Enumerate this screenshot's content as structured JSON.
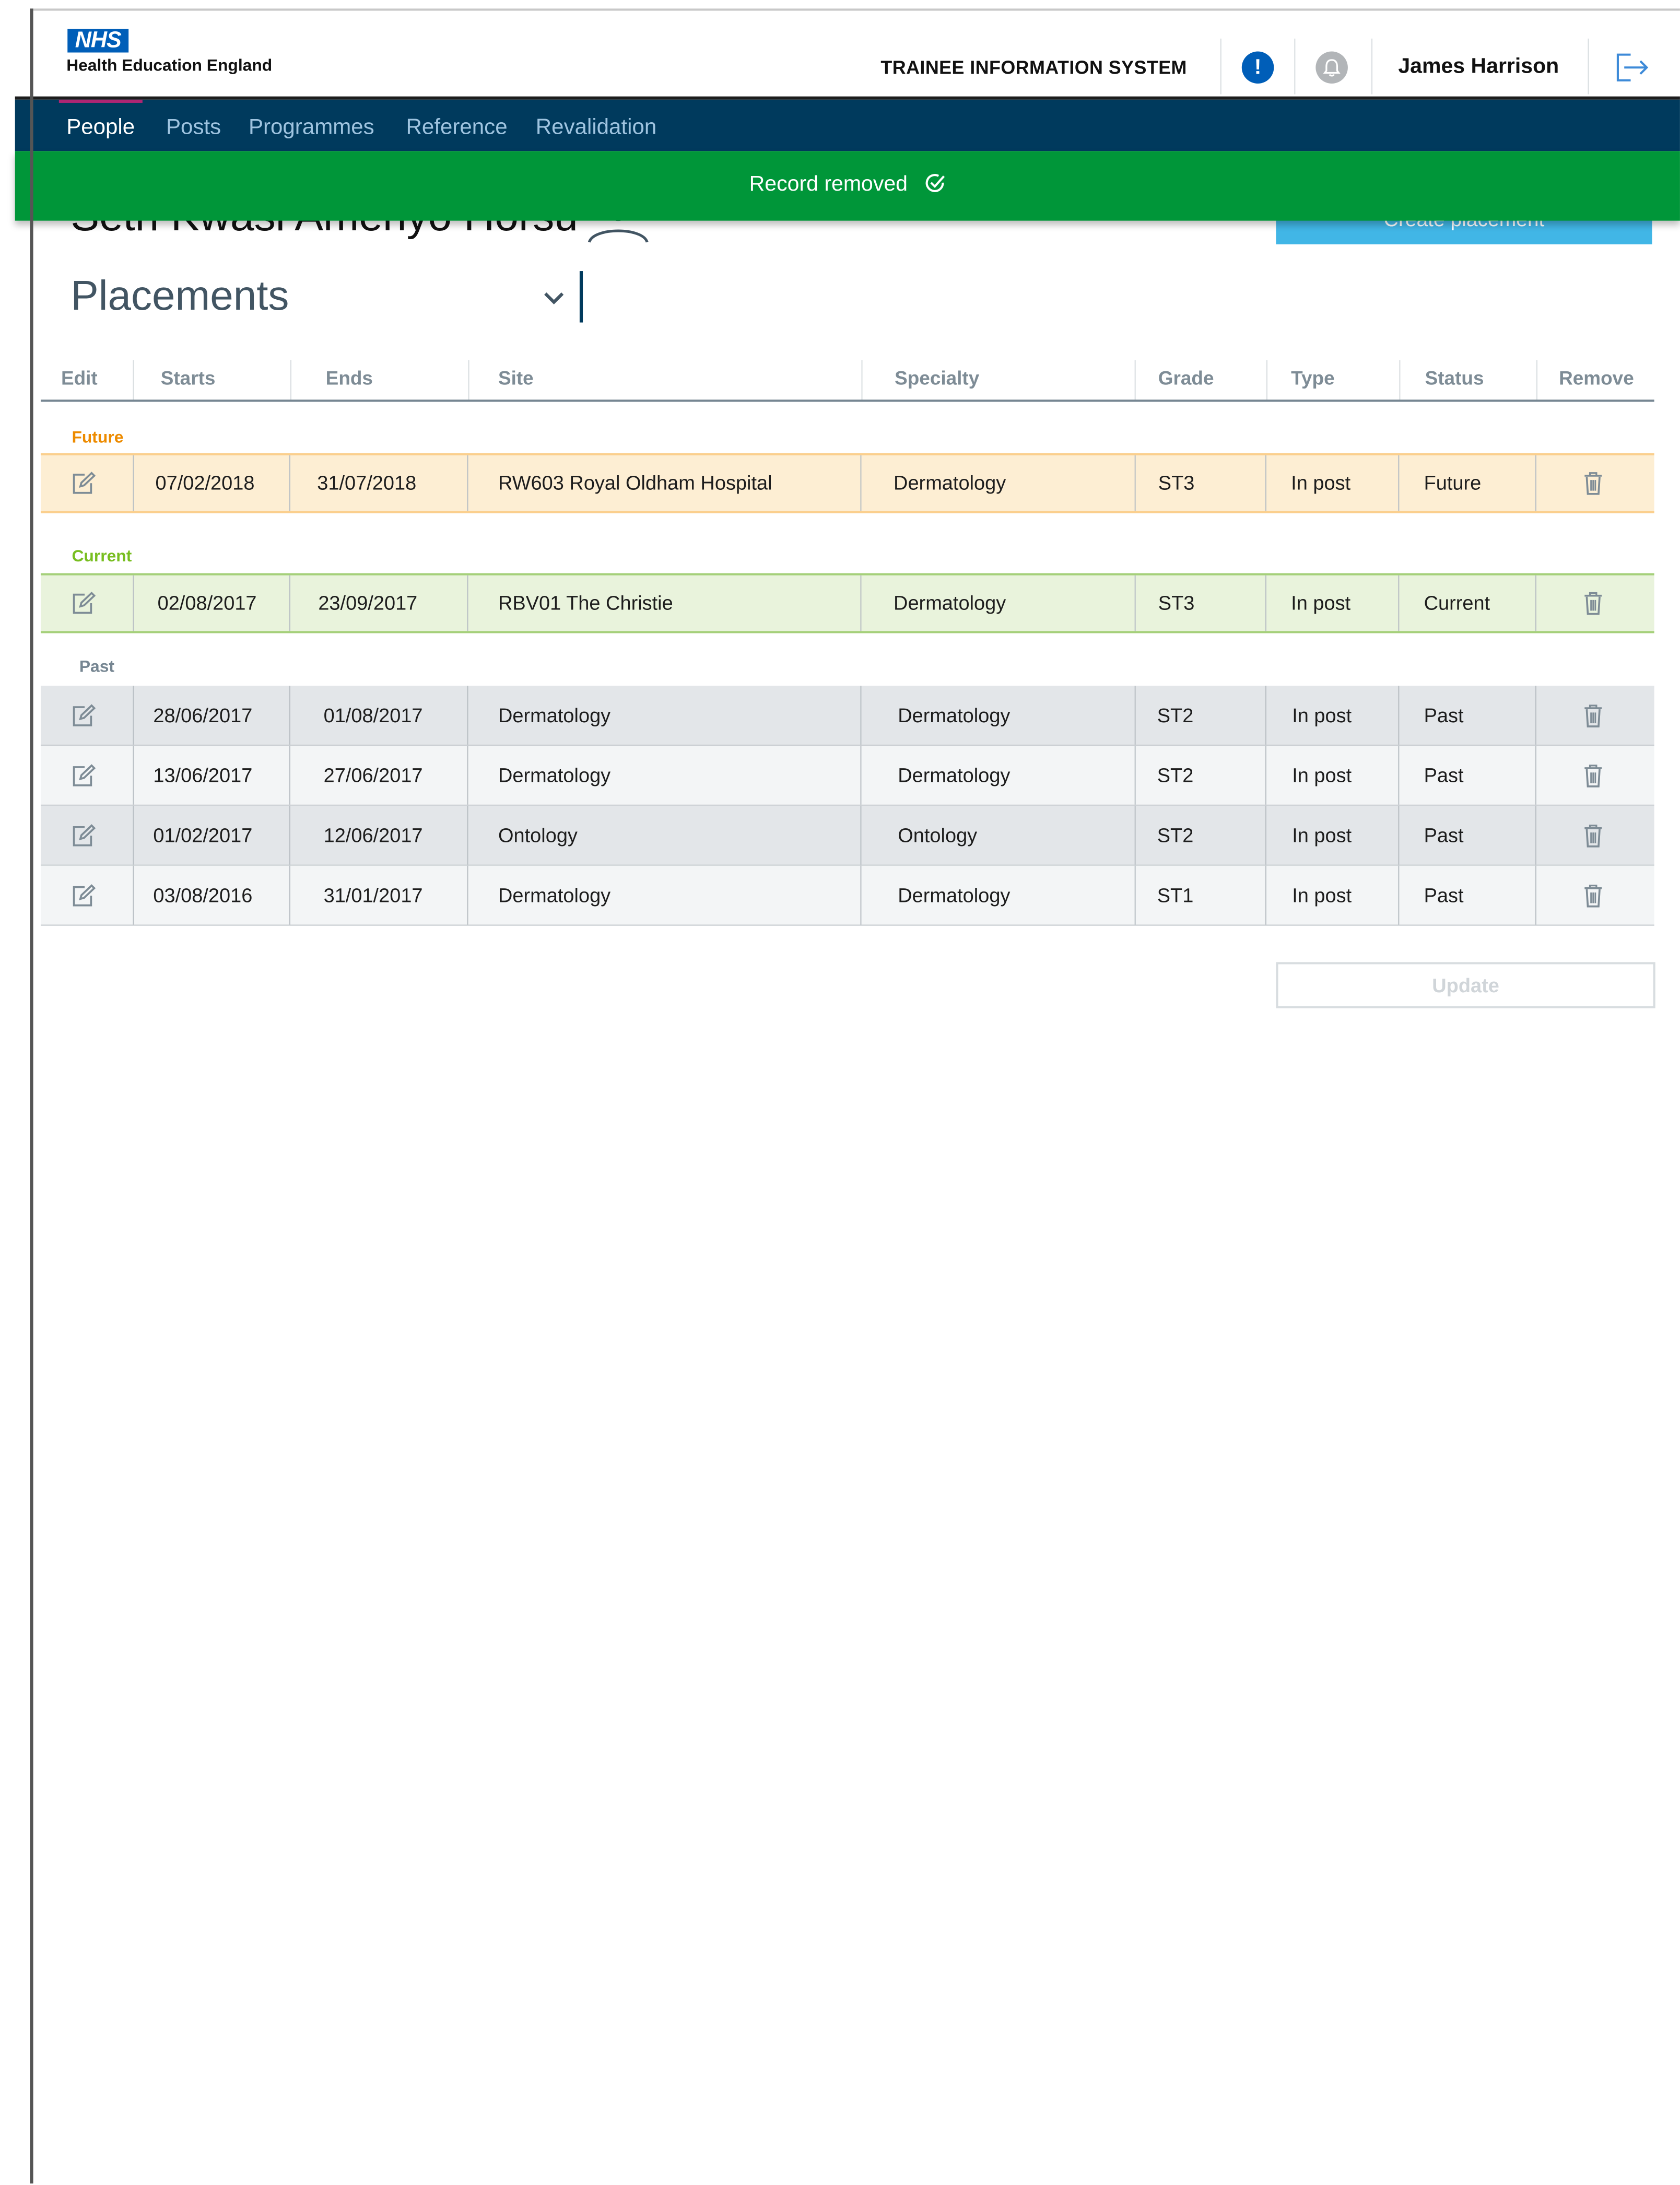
{
  "header": {
    "logo": "NHS",
    "org_name": "Health Education England",
    "system_title": "TRAINEE INFORMATION SYSTEM",
    "alert_icon": "alert-icon",
    "alert_glyph": "!",
    "notification_icon": "bell-icon",
    "user_name": "James Harrison",
    "logout_icon": "logout-icon"
  },
  "nav": {
    "items": [
      "People",
      "Posts",
      "Programmes",
      "Reference",
      "Revalidation"
    ],
    "active": "People"
  },
  "toast": {
    "message": "Record removed",
    "icon": "check-circle-icon",
    "color": "#009639"
  },
  "person": {
    "name": "Seth Kwasi Amenyo Horsu",
    "icon": "person-icon"
  },
  "actions": {
    "create_placement": "Create placement",
    "update": "Update"
  },
  "section": {
    "title": "Placements"
  },
  "table": {
    "headers": [
      "Edit",
      "Starts",
      "Ends",
      "Site",
      "Specialty",
      "Grade",
      "Type",
      "Status",
      "Remove"
    ],
    "groups": {
      "future": "Future",
      "current": "Current",
      "past": "Past"
    },
    "future_rows": [
      {
        "starts": "07/02/2018",
        "ends": "31/07/2018",
        "site": "RW603 Royal Oldham Hospital",
        "specialty": "Dermatology",
        "grade": "ST3",
        "type": "In post",
        "status": "Future"
      }
    ],
    "current_rows": [
      {
        "starts": "02/08/2017",
        "ends": "23/09/2017",
        "site": "RBV01 The Christie",
        "specialty": "Dermatology",
        "grade": "ST3",
        "type": "In post",
        "status": "Current"
      }
    ],
    "past_rows": [
      {
        "starts": "28/06/2017",
        "ends": "01/08/2017",
        "site": "Dermatology",
        "specialty": "Dermatology",
        "grade": "ST2",
        "type": "In post",
        "status": "Past"
      },
      {
        "starts": "13/06/2017",
        "ends": "27/06/2017",
        "site": "Dermatology",
        "specialty": "Dermatology",
        "grade": "ST2",
        "type": "In post",
        "status": "Past"
      },
      {
        "starts": "01/02/2017",
        "ends": "12/06/2017",
        "site": "Ontology",
        "specialty": "Ontology",
        "grade": "ST2",
        "type": "In post",
        "status": "Past"
      },
      {
        "starts": "03/08/2016",
        "ends": "31/01/2017",
        "site": "Dermatology",
        "specialty": "Dermatology",
        "grade": "ST1",
        "type": "In post",
        "status": "Past"
      }
    ]
  },
  "colors": {
    "nhs_blue": "#005eb8",
    "nav_bg": "#003a5d",
    "future_label": "#ed8b00",
    "current_label": "#78be20",
    "past_label": "#768692",
    "create_button": "#41b6e6"
  }
}
